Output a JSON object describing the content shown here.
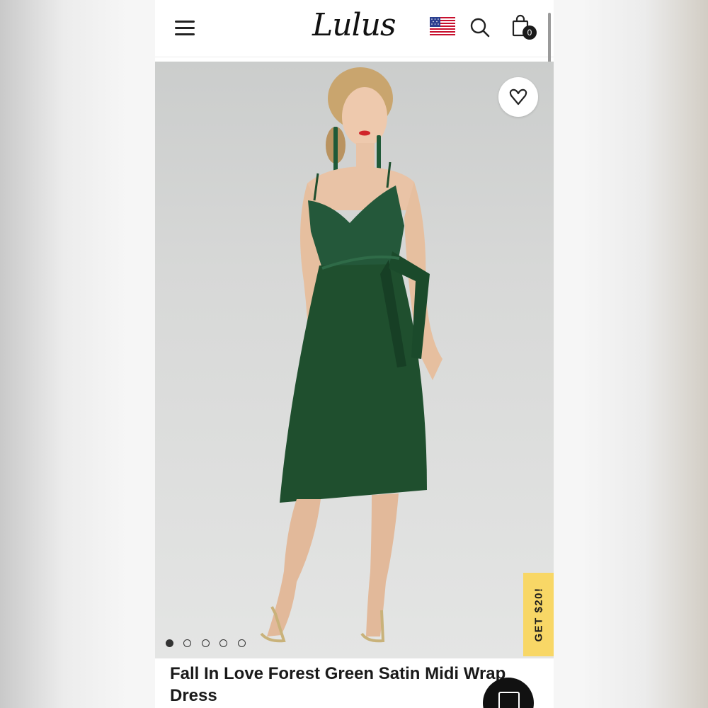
{
  "header": {
    "logo_text": "Lulus",
    "menu_icon": "hamburger-menu-icon",
    "flag_icon": "us-flag-icon",
    "search_icon": "search-icon",
    "cart_icon": "shopping-bag-icon",
    "cart_count": "0"
  },
  "product": {
    "title": "Fall In Love Forest Green Satin Midi Wrap Dress",
    "dress_color": "#1f4f2e",
    "wishlist_icon": "heart-icon",
    "image_count": 5,
    "active_image_index": 0
  },
  "promo": {
    "label": "GET $20!",
    "color": "#f8d766"
  },
  "chat": {
    "icon": "chat-icon"
  }
}
